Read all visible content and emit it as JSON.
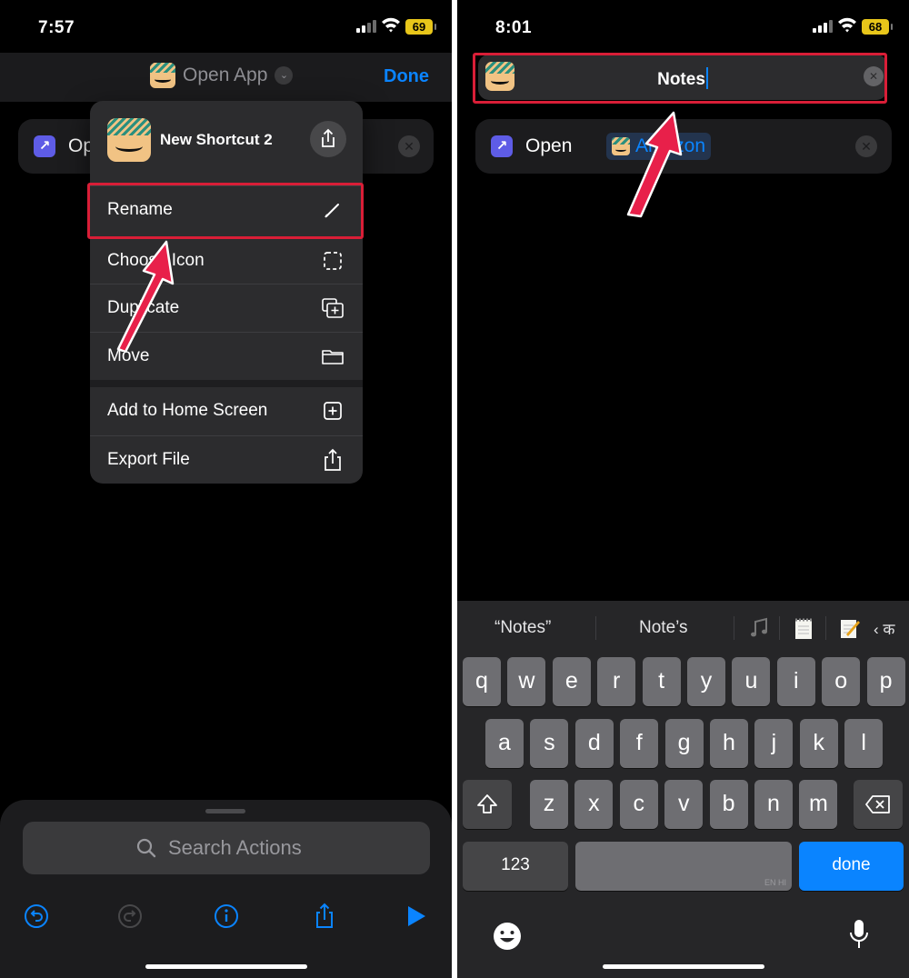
{
  "left": {
    "status": {
      "time": "7:57",
      "battery": "69"
    },
    "header": {
      "title": "Open App",
      "done_label": "Done"
    },
    "action": {
      "verb_partial": "Op"
    },
    "menu": {
      "shortcut_name": "New Shortcut 2",
      "items": [
        {
          "label": "Rename",
          "icon": "pencil-icon"
        },
        {
          "label": "Choose Icon",
          "icon": "dashed-square-icon"
        },
        {
          "label": "Duplicate",
          "icon": "duplicate-icon"
        },
        {
          "label": "Move",
          "icon": "folder-icon"
        },
        {
          "label": "Add to Home Screen",
          "icon": "plus-square-icon"
        },
        {
          "label": "Export File",
          "icon": "share-icon"
        }
      ]
    },
    "search": {
      "placeholder": "Search Actions"
    },
    "toolbar": [
      "undo-icon",
      "redo-icon",
      "info-icon",
      "share-icon",
      "play-icon"
    ]
  },
  "right": {
    "status": {
      "time": "8:01",
      "battery": "68"
    },
    "name_field": {
      "value": "Notes"
    },
    "action": {
      "verb": "Open",
      "app": "Amazon"
    },
    "keyboard": {
      "suggestions": [
        "“Notes”",
        "Note’s",
        "‹ क"
      ],
      "row1": [
        "q",
        "w",
        "e",
        "r",
        "t",
        "y",
        "u",
        "i",
        "o",
        "p"
      ],
      "row2": [
        "a",
        "s",
        "d",
        "f",
        "g",
        "h",
        "j",
        "k",
        "l"
      ],
      "row3": [
        "z",
        "x",
        "c",
        "v",
        "b",
        "n",
        "m"
      ],
      "numbers_label": "123",
      "space_hint": "EN HI",
      "done_label": "done"
    }
  },
  "colors": {
    "highlight": "#d91e37",
    "accent": "#0a84ff",
    "arrow": "#e8204a"
  }
}
